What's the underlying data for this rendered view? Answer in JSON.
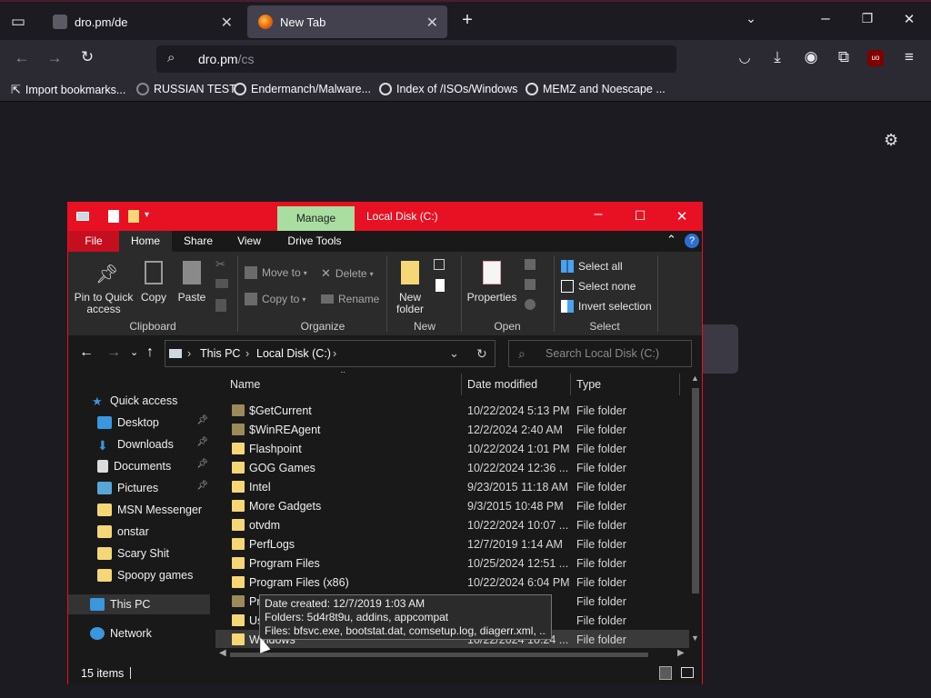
{
  "browser": {
    "tabs": [
      {
        "title": "dro.pm/de"
      },
      {
        "title": "New Tab"
      }
    ],
    "url": {
      "host": "dro.pm",
      "path": "/cs"
    },
    "bookmarks": [
      "Import bookmarks...",
      "RUSSIAN TEST",
      "Endermanch/Malware...",
      "Index of /ISOs/Windows",
      "MEMZ and Noescape ..."
    ],
    "extension_badge": "uo"
  },
  "explorer": {
    "title": "Local Disk (C:)",
    "manage_label": "Manage",
    "ribbon_tabs": [
      "File",
      "Home",
      "Share",
      "View",
      "Drive Tools"
    ],
    "active_tab": "Home",
    "ribbon": {
      "pin_label": "Pin to Quick access",
      "copy_label": "Copy",
      "paste_label": "Paste",
      "move_to": "Move to",
      "copy_to": "Copy to",
      "delete": "Delete",
      "rename": "Rename",
      "new_folder": "New folder",
      "properties": "Properties",
      "select_all": "Select all",
      "select_none": "Select none",
      "invert_selection": "Invert selection",
      "groups": [
        "Clipboard",
        "Organize",
        "New",
        "Open",
        "Select"
      ]
    },
    "breadcrumb": [
      "This PC",
      "Local Disk (C:)"
    ],
    "search_placeholder": "Search Local Disk (C:)",
    "nav": {
      "quick_access": "Quick access",
      "pinned": [
        "Desktop",
        "Downloads",
        "Documents",
        "Pictures"
      ],
      "folders": [
        "MSN Messenger",
        "onstar",
        "Scary Shit",
        "Spoopy games"
      ],
      "this_pc": "This PC",
      "network": "Network"
    },
    "columns": [
      "Name",
      "Date modified",
      "Type"
    ],
    "files": [
      {
        "name": "$GetCurrent",
        "date": "10/22/2024 5:13 PM",
        "type": "File folder"
      },
      {
        "name": "$WinREAgent",
        "date": "12/2/2024 2:40 AM",
        "type": "File folder"
      },
      {
        "name": "Flashpoint",
        "date": "10/22/2024 1:01 PM",
        "type": "File folder"
      },
      {
        "name": "GOG Games",
        "date": "10/22/2024 12:36 ...",
        "type": "File folder"
      },
      {
        "name": "Intel",
        "date": "9/23/2015 11:18 AM",
        "type": "File folder"
      },
      {
        "name": "More Gadgets",
        "date": "9/3/2015 10:48 PM",
        "type": "File folder"
      },
      {
        "name": "otvdm",
        "date": "10/22/2024 10:07 ...",
        "type": "File folder"
      },
      {
        "name": "PerfLogs",
        "date": "12/7/2019 1:14 AM",
        "type": "File folder"
      },
      {
        "name": "Program Files",
        "date": "10/25/2024 12:51 ...",
        "type": "File folder"
      },
      {
        "name": "Program Files (x86)",
        "date": "10/22/2024 6:04 PM",
        "type": "File folder"
      },
      {
        "name": "Pr",
        "date": "",
        "type": "File folder"
      },
      {
        "name": "Us",
        "date": "",
        "type": "File folder"
      },
      {
        "name": "Windows",
        "date": "10/22/2024 10:24 ...",
        "type": "File folder"
      }
    ],
    "tooltip": {
      "line1": "Date created: 12/7/2019 1:03 AM",
      "line2": "Folders: 5d4r8t9u, addins, appcompat",
      "line3": "Files: bfsvc.exe, bootstat.dat, comsetup.log, diagerr.xml, ..."
    },
    "status": "15 items"
  },
  "colors": {
    "titlebar": "#e81123",
    "manage": "#a9dea0",
    "folder": "#f6d776"
  }
}
